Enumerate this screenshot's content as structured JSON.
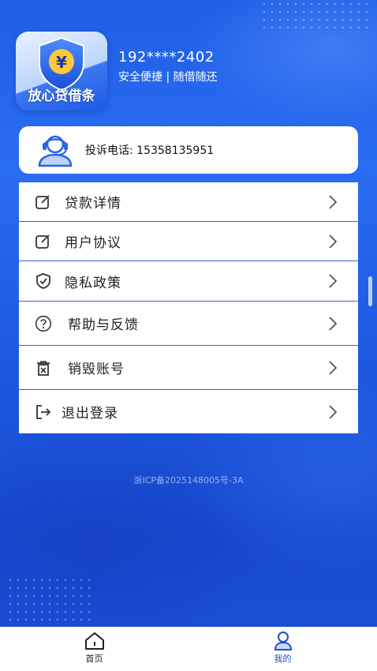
{
  "app": {
    "logo_text": "放心贷借条",
    "user_phone": "192****2402",
    "slogan": "安全便捷 | 随借随还"
  },
  "complaint": {
    "icon": "customer-service-icon",
    "text": "投诉电话: 15358135951"
  },
  "menu": {
    "items": [
      {
        "label": "贷款详情",
        "icon": "edit-icon"
      },
      {
        "label": "用户协议",
        "icon": "edit-icon"
      },
      {
        "label": "隐私政策",
        "icon": "shield-check-icon"
      },
      {
        "label": "帮助与反馈",
        "icon": "help-icon"
      },
      {
        "label": "销毁账号",
        "icon": "delete-icon"
      },
      {
        "label": "退出登录",
        "icon": "logout-icon"
      }
    ]
  },
  "footer": {
    "icp": "浙ICP备2025148005号-3A"
  },
  "tabbar": {
    "tabs": [
      {
        "label": "首页",
        "icon": "home-icon",
        "active": false
      },
      {
        "label": "我的",
        "icon": "user-icon",
        "active": true
      }
    ]
  },
  "colors": {
    "background": "#1f5fe6",
    "accent": "#1d4fc9",
    "divider": "#3a66c7"
  }
}
